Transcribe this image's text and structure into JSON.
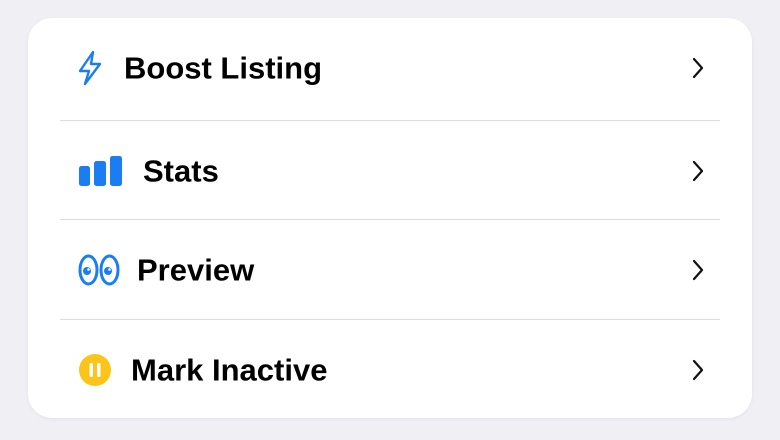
{
  "menu": {
    "items": [
      {
        "label": "Boost Listing",
        "icon": "lightning-bolt-icon"
      },
      {
        "label": "Stats",
        "icon": "bar-chart-icon"
      },
      {
        "label": "Preview",
        "icon": "eyes-icon"
      },
      {
        "label": "Mark Inactive",
        "icon": "pause-circle-icon"
      }
    ]
  },
  "colors": {
    "accent_blue": "#1a7ef2",
    "pause_yellow": "#fcc419",
    "background": "#efeff4",
    "card": "#ffffff"
  }
}
